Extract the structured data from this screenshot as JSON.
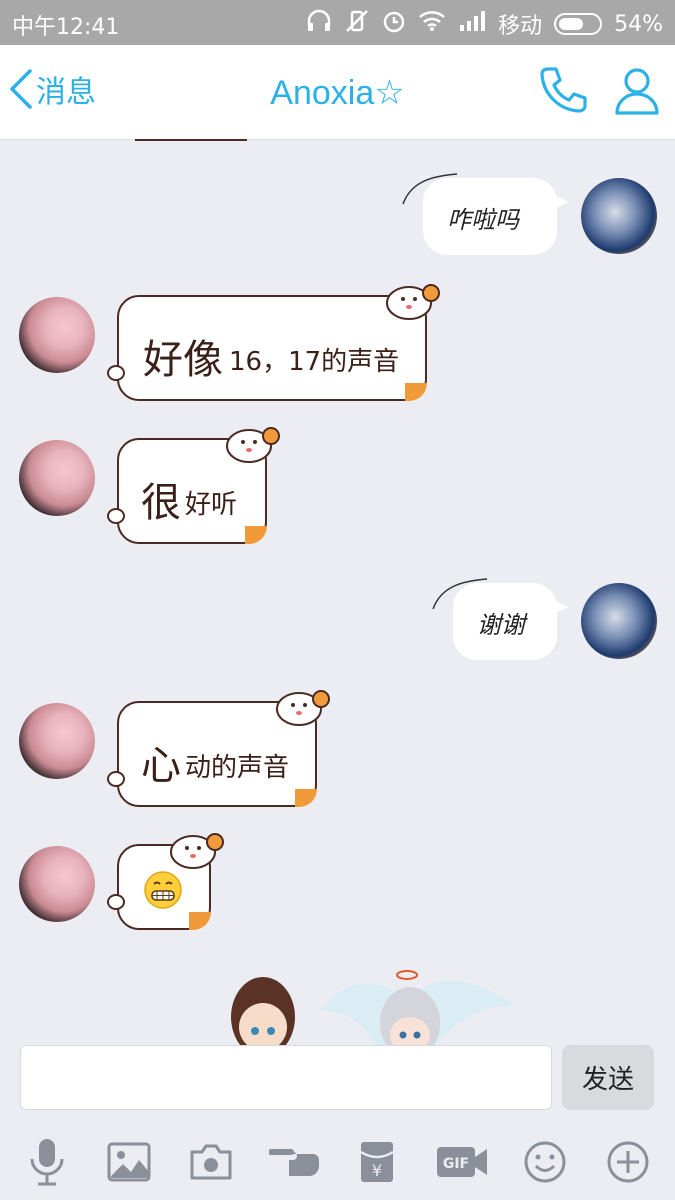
{
  "statusbar": {
    "time": "中午12:41",
    "carrier": "移动",
    "battery": "54%"
  },
  "header": {
    "back_label": "消息",
    "title": "Anoxia☆"
  },
  "messages": [
    {
      "side": "right",
      "text": "咋啦吗"
    },
    {
      "side": "left",
      "big": "好像",
      "small": "16，17的声音"
    },
    {
      "side": "left",
      "big": "很",
      "small": "好听"
    },
    {
      "side": "right",
      "text": "谢谢"
    },
    {
      "side": "left",
      "big": "心",
      "small": "动的声音"
    },
    {
      "side": "left",
      "emoji": "😁"
    }
  ],
  "input": {
    "value": "",
    "send_label": "发送"
  },
  "toolbar_icons": [
    "mic-icon",
    "image-icon",
    "camera-icon",
    "poke-icon",
    "red-packet-icon",
    "gif-icon",
    "emoji-icon",
    "plus-icon"
  ],
  "colors": {
    "accent": "#2bb1e8",
    "bubble_border": "#4a2a22",
    "bubble_accent": "#f19a3a",
    "icon": "#8a8f99"
  }
}
